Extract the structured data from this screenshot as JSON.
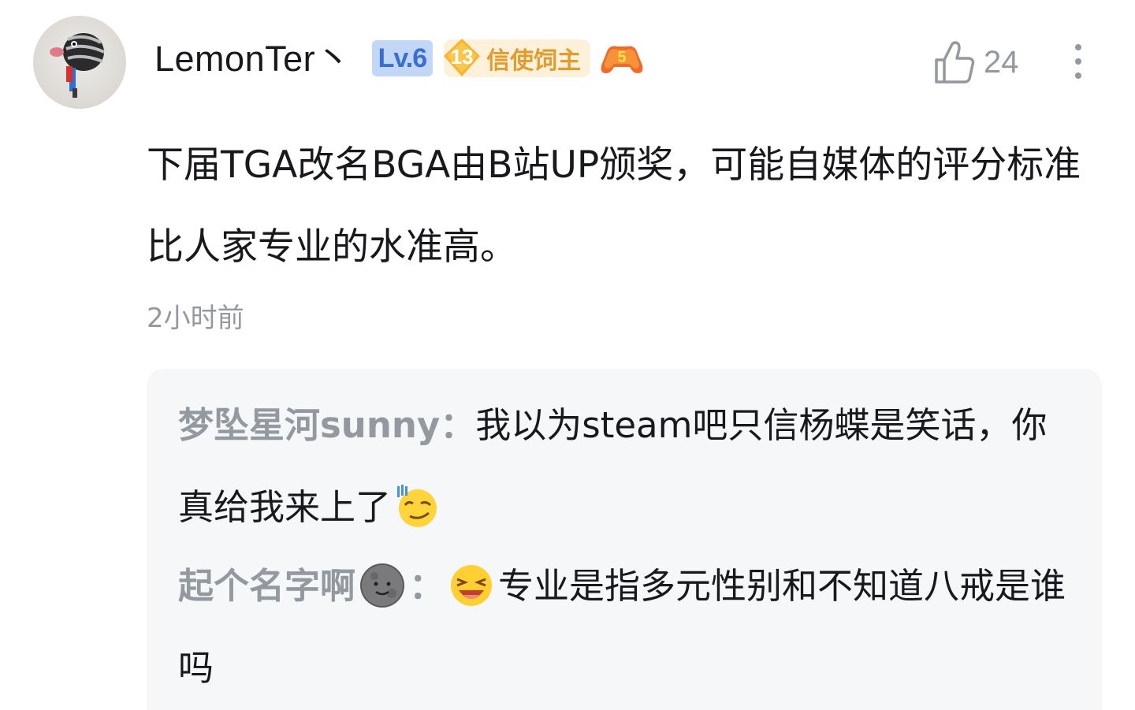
{
  "comment": {
    "user": {
      "name": "LemonTer丶",
      "level_badge": "Lv.6",
      "fan_medal": {
        "level": "13",
        "name": "信使饲主"
      },
      "guard_badge_level": "5"
    },
    "likes": "24",
    "text": "下届TGA改名BGA由B站UP颁奖，可能自媒体的评分标准比人家专业的水准高。",
    "time": "2小时前"
  },
  "replies": [
    {
      "user": "梦坠星河sunny",
      "separator": "：",
      "text": "我以为steam吧只信杨蝶是笑话，你真给我来上了",
      "trailing_emoji": "smirk-emoji"
    },
    {
      "user": "起个名字啊",
      "user_emoji": "moon-face-emoji",
      "separator": "：",
      "leading_emoji": "laughing-emoji",
      "text": "专业是指多元性别和不知道八戒是谁吗"
    }
  ],
  "colors": {
    "username": "#18191c",
    "secondary_text": "#9499a0",
    "level_badge_bg": "#c2d6f6",
    "level_badge_text": "#3a6fd0",
    "fan_medal_bg": "#fdf1dc",
    "fan_medal_text": "#e09c2c",
    "reply_panel_bg": "#f6f7f9"
  },
  "icons": {
    "like": "thumbs-up-icon",
    "more": "more-vertical-icon",
    "guard": "gamepad-icon"
  }
}
